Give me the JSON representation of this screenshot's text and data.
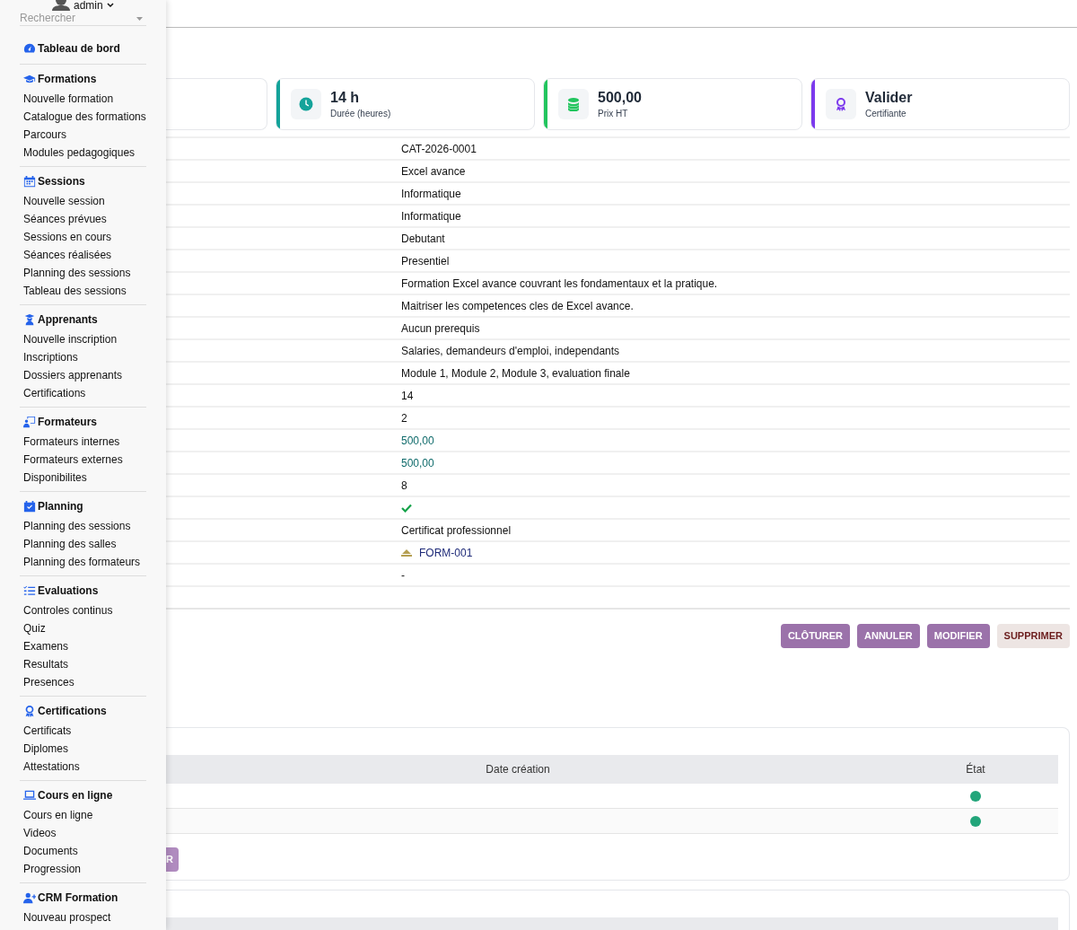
{
  "sidebar": {
    "user": "admin",
    "search": {
      "placeholder": "Rechercher"
    },
    "sections": [
      {
        "title": "Tableau de bord"
      },
      {
        "title": "Formations",
        "items": [
          "Nouvelle formation",
          "Catalogue des formations",
          "Parcours",
          "Modules pedagogiques"
        ]
      },
      {
        "title": "Sessions",
        "items": [
          "Nouvelle session",
          "Séances prévues",
          "Sessions en cours",
          "Séances réalisées",
          "Planning des sessions",
          "Tableau des sessions"
        ]
      },
      {
        "title": "Apprenants",
        "items": [
          "Nouvelle inscription",
          "Inscriptions",
          "Dossiers apprenants",
          "Certifications"
        ]
      },
      {
        "title": "Formateurs",
        "items": [
          "Formateurs internes",
          "Formateurs externes",
          "Disponibilites"
        ]
      },
      {
        "title": "Planning",
        "items": [
          "Planning des sessions",
          "Planning des salles",
          "Planning des formateurs"
        ]
      },
      {
        "title": "Evaluations",
        "items": [
          "Controles continus",
          "Quiz",
          "Examens",
          "Resultats",
          "Presences"
        ]
      },
      {
        "title": "Certifications",
        "items": [
          "Certificats",
          "Diplomes",
          "Attestations"
        ]
      },
      {
        "title": "Cours en ligne",
        "items": [
          "Cours en ligne",
          "Videos",
          "Documents",
          "Progression"
        ]
      },
      {
        "title": "CRM Formation",
        "items": [
          "Nouveau prospect"
        ]
      }
    ]
  },
  "stats": [
    {
      "value": "14 h",
      "label": "Durée (heures)",
      "color": "#14a39a"
    },
    {
      "value": "500,00",
      "label": "Prix HT",
      "color": "#22c55e"
    },
    {
      "value": "Valider",
      "label": "Certifiante",
      "color": "#7c3aed"
    }
  ],
  "details": [
    {
      "kind": "text",
      "value": "CAT-2026-0001"
    },
    {
      "kind": "text",
      "value": "Excel avance"
    },
    {
      "kind": "text",
      "value": "Informatique"
    },
    {
      "kind": "text",
      "value": "Informatique"
    },
    {
      "kind": "text",
      "value": "Debutant"
    },
    {
      "kind": "text",
      "value": "Presentiel"
    },
    {
      "kind": "text",
      "value": "Formation Excel avance couvrant les fondamentaux et la pratique."
    },
    {
      "kind": "text",
      "value": "Maitriser les competences cles de Excel avance."
    },
    {
      "kind": "text",
      "value": "Aucun prerequis"
    },
    {
      "kind": "text",
      "value": "Salaries, demandeurs d'emploi, independants"
    },
    {
      "kind": "text",
      "value": "Module 1, Module 2, Module 3, evaluation finale"
    },
    {
      "kind": "text",
      "value": "14"
    },
    {
      "kind": "text",
      "value": "2"
    },
    {
      "kind": "amount",
      "value": "500,00"
    },
    {
      "kind": "amount",
      "value": "500,00"
    },
    {
      "kind": "text",
      "value": "8"
    },
    {
      "kind": "check",
      "checked": true
    },
    {
      "kind": "text",
      "value": "Certificat professionnel"
    },
    {
      "kind": "link",
      "value": "FORM-001"
    },
    {
      "kind": "text",
      "value": "-"
    }
  ],
  "actions": [
    {
      "label": "CLÔTURER",
      "kind": "primary"
    },
    {
      "label": "ANNULER",
      "kind": "primary"
    },
    {
      "label": "MODIFIER",
      "kind": "primary"
    },
    {
      "label": "SUPPRIMER",
      "kind": "danger"
    }
  ],
  "list_table": {
    "columns": [
      "Date création",
      "État"
    ],
    "rows": [
      {
        "color": "#22a57a"
      },
      {
        "color": "#22a57a"
      }
    ],
    "button": "R"
  }
}
